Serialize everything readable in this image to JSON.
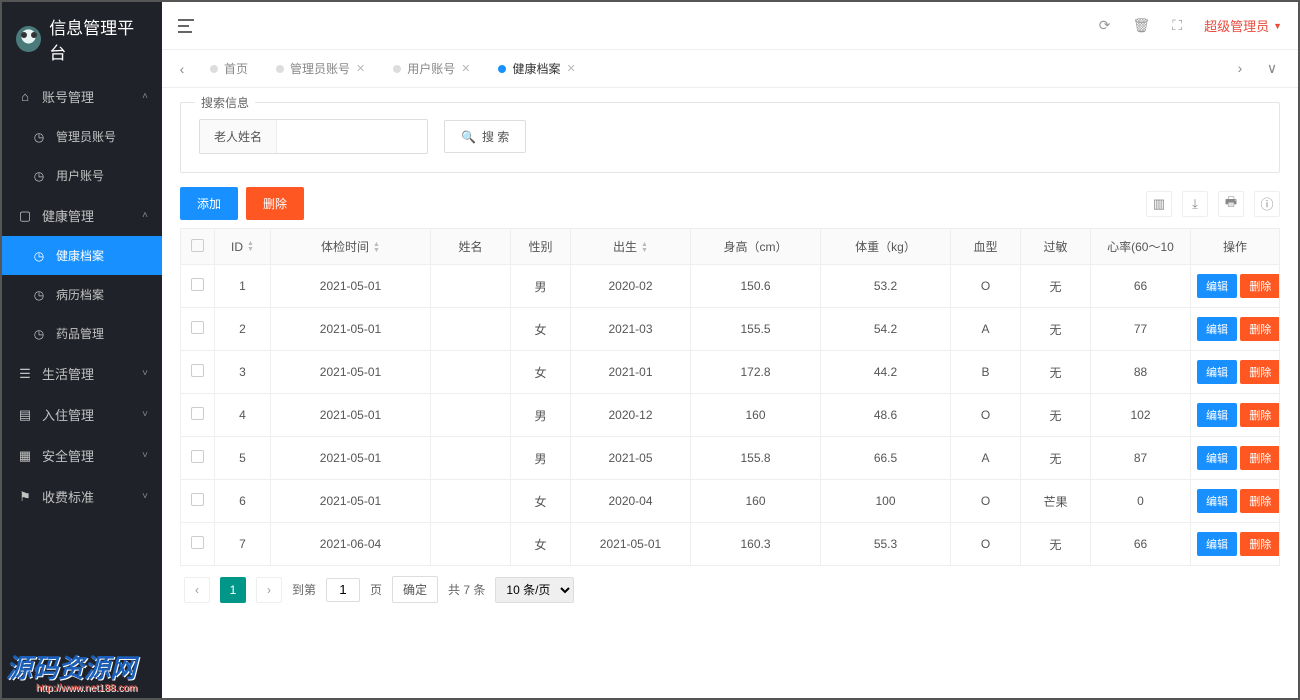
{
  "brand": "信息管理平台",
  "user_role": "超级管理员",
  "sidebar": {
    "sections": [
      {
        "label": "账号管理",
        "icon": "home",
        "expanded": true,
        "children": [
          {
            "label": "管理员账号",
            "icon": "gauge"
          },
          {
            "label": "用户账号",
            "icon": "gauge"
          }
        ]
      },
      {
        "label": "健康管理",
        "icon": "window",
        "expanded": true,
        "children": [
          {
            "label": "健康档案",
            "icon": "gauge",
            "active": true
          },
          {
            "label": "病历档案",
            "icon": "gauge"
          },
          {
            "label": "药品管理",
            "icon": "gauge"
          }
        ]
      },
      {
        "label": "生活管理",
        "icon": "sliders",
        "expanded": false
      },
      {
        "label": "入住管理",
        "icon": "file",
        "expanded": false
      },
      {
        "label": "安全管理",
        "icon": "calendar",
        "expanded": false
      },
      {
        "label": "收费标准",
        "icon": "flag",
        "expanded": false
      }
    ]
  },
  "tabs": [
    {
      "label": "首页",
      "closable": false
    },
    {
      "label": "管理员账号",
      "closable": true
    },
    {
      "label": "用户账号",
      "closable": true
    },
    {
      "label": "健康档案",
      "closable": true,
      "active": true
    }
  ],
  "search": {
    "legend": "搜索信息",
    "field_label": "老人姓名",
    "field_value": "",
    "search_btn": "搜 索"
  },
  "toolbar": {
    "add": "添加",
    "delete": "删除"
  },
  "columns": [
    "",
    "ID",
    "体检时间",
    "姓名",
    "性别",
    "出生",
    "身高（cm）",
    "体重（kg）",
    "血型",
    "过敏",
    "心率(60～10",
    "操作"
  ],
  "rows": [
    {
      "id": "1",
      "date": "2021-05-01",
      "name": "",
      "sex": "男",
      "birth": "2020-02",
      "height": "150.6",
      "weight": "53.2",
      "blood": "O",
      "allergy": "无",
      "hr": "66"
    },
    {
      "id": "2",
      "date": "2021-05-01",
      "name": "",
      "sex": "女",
      "birth": "2021-03",
      "height": "155.5",
      "weight": "54.2",
      "blood": "A",
      "allergy": "无",
      "hr": "77"
    },
    {
      "id": "3",
      "date": "2021-05-01",
      "name": "",
      "sex": "女",
      "birth": "2021-01",
      "height": "172.8",
      "weight": "44.2",
      "blood": "B",
      "allergy": "无",
      "hr": "88"
    },
    {
      "id": "4",
      "date": "2021-05-01",
      "name": "",
      "sex": "男",
      "birth": "2020-12",
      "height": "160",
      "weight": "48.6",
      "blood": "O",
      "allergy": "无",
      "hr": "102"
    },
    {
      "id": "5",
      "date": "2021-05-01",
      "name": "",
      "sex": "男",
      "birth": "2021-05",
      "height": "155.8",
      "weight": "66.5",
      "blood": "A",
      "allergy": "无",
      "hr": "87"
    },
    {
      "id": "6",
      "date": "2021-05-01",
      "name": "",
      "sex": "女",
      "birth": "2020-04",
      "height": "160",
      "weight": "100",
      "blood": "O",
      "allergy": "芒果",
      "hr": "0"
    },
    {
      "id": "7",
      "date": "2021-06-04",
      "name": "",
      "sex": "女",
      "birth": "2021-05-01",
      "height": "160.3",
      "weight": "55.3",
      "blood": "O",
      "allergy": "无",
      "hr": "66"
    }
  ],
  "row_actions": {
    "edit": "编辑",
    "delete": "删除"
  },
  "pagination": {
    "current": "1",
    "goto_label": "到第",
    "goto_value": "1",
    "page_label": "页",
    "confirm": "确定",
    "total": "共 7 条",
    "per_page": "10 条/页"
  },
  "watermark": {
    "text": "源码资源网",
    "url": "http://www.net188.com"
  }
}
